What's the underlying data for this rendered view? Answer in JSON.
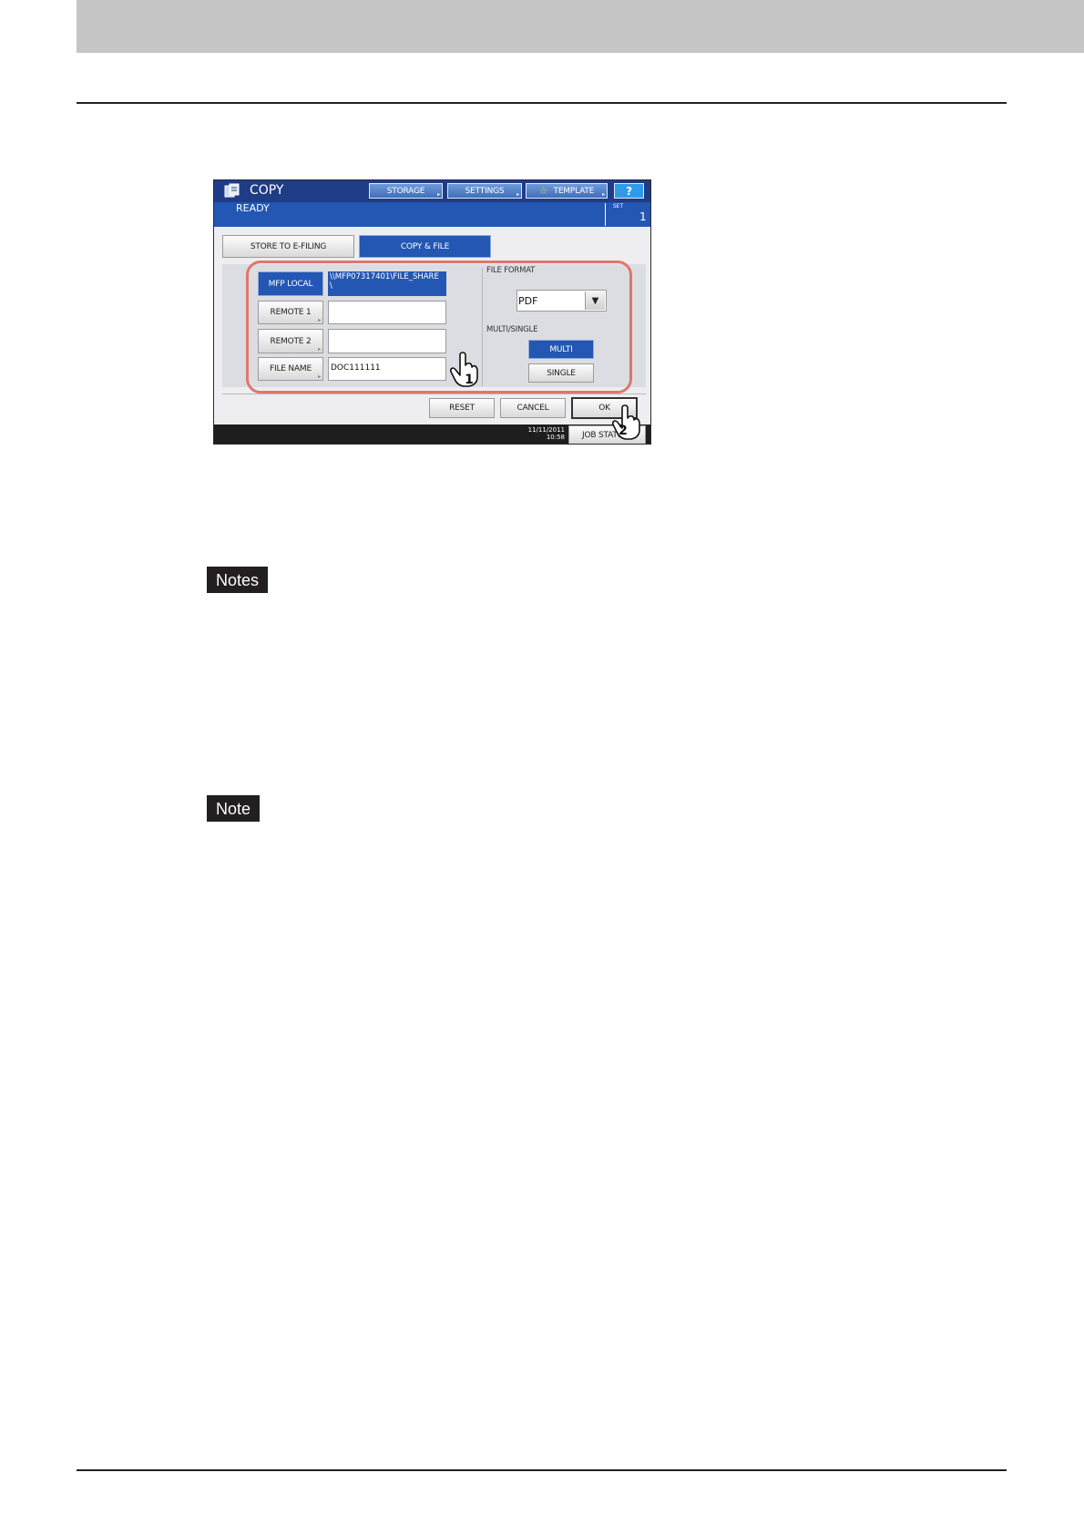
{
  "page": {
    "notes_tag": "Notes",
    "note_tag": "Note"
  },
  "screen": {
    "app_title": "COPY",
    "status": "READY",
    "set_label": "SET",
    "set_value": "1",
    "toolbar": {
      "storage": "STORAGE",
      "settings": "SETTINGS",
      "template": "TEMPLATE",
      "help": "?"
    },
    "tabs": {
      "store_to_efiling": "STORE TO E-FILING",
      "copy_and_file": "COPY & FILE"
    },
    "destinations": {
      "mfp_local": "MFP LOCAL",
      "mfp_local_path_line1": "\\\\MFP07317401\\FILE_SHARE",
      "mfp_local_path_line2": "\\",
      "remote1": "REMOTE 1",
      "remote1_value": "",
      "remote2": "REMOTE 2",
      "remote2_value": "",
      "file_name": "FILE NAME",
      "file_name_value": "DOC111111"
    },
    "file_format": {
      "label": "FILE FORMAT",
      "value": "PDF"
    },
    "multi_single": {
      "label": "MULTI/SINGLE",
      "multi": "MULTI",
      "single": "SINGLE"
    },
    "actions": {
      "reset": "RESET",
      "cancel": "CANCEL",
      "ok": "OK"
    },
    "footer": {
      "date": "11/11/2011",
      "time": "10:58",
      "job_status": "JOB STATUS"
    },
    "callouts": {
      "step1": "1",
      "step2": "2"
    },
    "colors": {
      "accent_blue": "#2357b3",
      "highlight": "#e0766b"
    }
  }
}
